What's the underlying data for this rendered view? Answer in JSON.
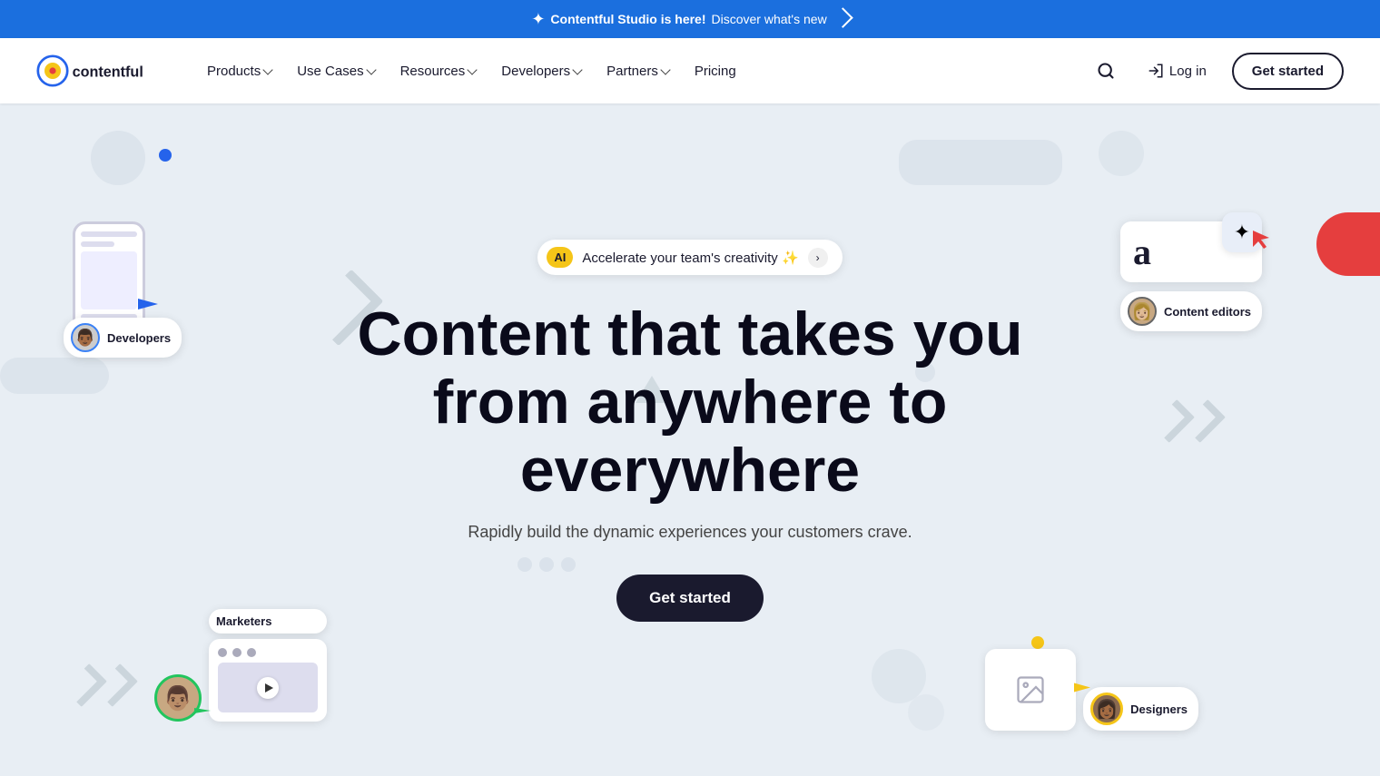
{
  "announcement": {
    "icon": "✦",
    "bold_text": "Contentful Studio is here!",
    "link_text": "Discover what's new",
    "link_arrow": "›"
  },
  "nav": {
    "logo_alt": "Contentful",
    "links": [
      {
        "label": "Products",
        "has_dropdown": true
      },
      {
        "label": "Use Cases",
        "has_dropdown": true
      },
      {
        "label": "Resources",
        "has_dropdown": true
      },
      {
        "label": "Developers",
        "has_dropdown": true
      },
      {
        "label": "Partners",
        "has_dropdown": true
      },
      {
        "label": "Pricing",
        "has_dropdown": false
      }
    ],
    "search_label": "Search",
    "login_label": "Log in",
    "cta_label": "Get started"
  },
  "hero": {
    "ai_badge": "AI",
    "ai_text": "Accelerate your team's creativity ✨",
    "ai_arrow": "›",
    "title_line1": "Content that takes you",
    "title_line2": "from anywhere to",
    "title_line3": "everywhere",
    "subtitle": "Rapidly build the dynamic experiences your customers crave.",
    "cta_label": "Get started",
    "floating": {
      "developers_label": "Developers",
      "content_editors_label": "Content editors",
      "marketers_label": "Marketers",
      "designers_label": "Designers"
    }
  }
}
